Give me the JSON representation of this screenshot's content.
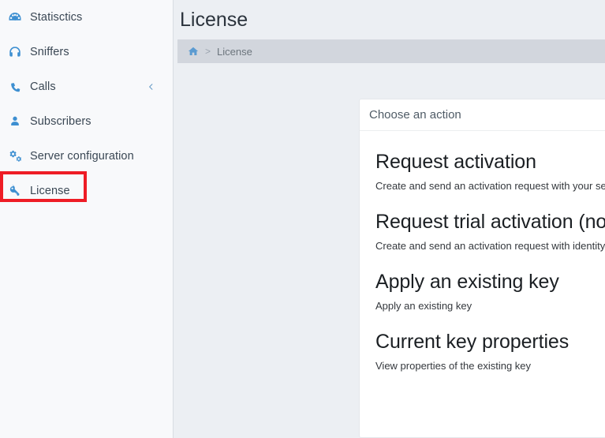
{
  "sidebar": {
    "items": [
      {
        "label": "Statisctics",
        "icon": "dashboard-icon",
        "selected": false,
        "chevron": null
      },
      {
        "label": "Sniffers",
        "icon": "headphones-icon",
        "selected": false,
        "chevron": null
      },
      {
        "label": "Calls",
        "icon": "phone-icon",
        "selected": false,
        "chevron": "chevron-left-icon"
      },
      {
        "label": "Subscribers",
        "icon": "user-icon",
        "selected": false,
        "chevron": null
      },
      {
        "label": "Server configuration",
        "icon": "cogs-icon",
        "selected": false,
        "chevron": null
      },
      {
        "label": "License",
        "icon": "key-icon",
        "selected": true,
        "chevron": null
      }
    ],
    "highlight_color": "#ee1c25",
    "icon_color": "#3d8fd1"
  },
  "header": {
    "title": "License"
  },
  "breadcrumb": {
    "home_icon": "home-icon",
    "separator": ">",
    "current": "License"
  },
  "card": {
    "header_title": "Choose an action",
    "actions": [
      {
        "title": "Request activation",
        "description": "Create and send an activation request with your serial number"
      },
      {
        "title": "Request trial activation (no serial number)",
        "description": "Create and send an activation request with identity information"
      },
      {
        "title": "Apply an existing key",
        "description": "Apply an existing key"
      },
      {
        "title": "Current key properties",
        "description": "View properties of the existing key"
      }
    ]
  }
}
